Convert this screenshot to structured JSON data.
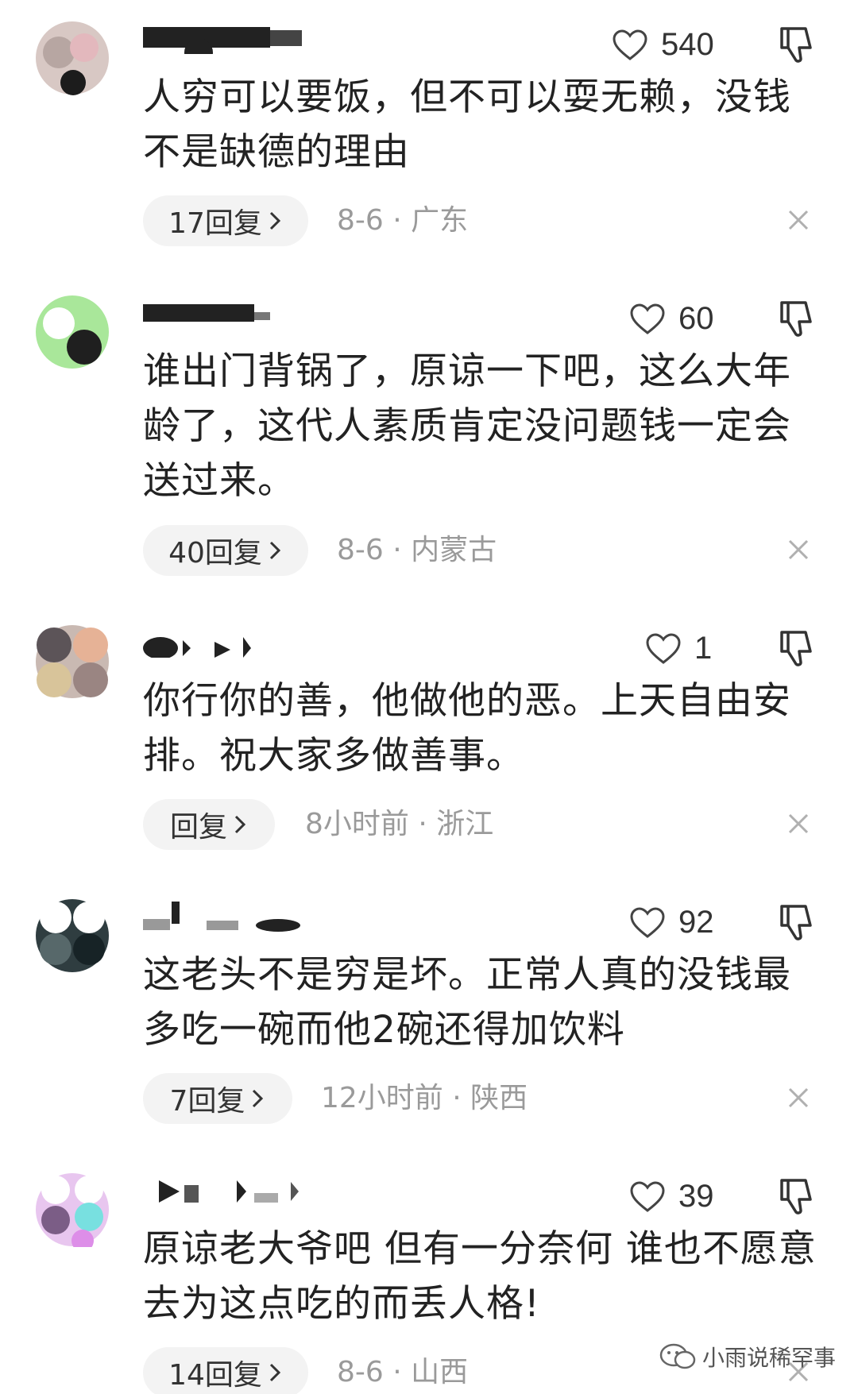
{
  "comments": [
    {
      "likes": "540",
      "text": "人穷可以要饭，但不可以耍无赖，没钱不是缺德的理由",
      "reply_label": "17回复",
      "meta": "8-6 · 广东"
    },
    {
      "likes": "60",
      "text": "谁出门背锅了，原谅一下吧，这么大年龄了，这代人素质肯定没问题钱一定会送过来。",
      "reply_label": "40回复",
      "meta": "8-6 · 内蒙古"
    },
    {
      "likes": "1",
      "text": "你行你的善，他做他的恶。上天自由安排。祝大家多做善事。",
      "reply_label": "回复",
      "meta": "8小时前 · 浙江"
    },
    {
      "likes": "92",
      "text": "这老头不是穷是坏。正常人真的没钱最多吃一碗而他2碗还得加饮料",
      "reply_label": "7回复",
      "meta": "12小时前 · 陕西"
    },
    {
      "likes": "39",
      "text": "原谅老大爷吧 但有一分奈何 谁也不愿意去为这点吃的而丢人格!",
      "reply_label": "14回复",
      "meta": "8-6 · 山西"
    }
  ],
  "watermark": {
    "text": "小雨说稀罕事",
    "icon": "wechat-icon"
  },
  "icons": {
    "like": "heart-outline-icon",
    "dislike": "thumbs-down-icon",
    "close": "close-icon",
    "chevron": "chevron-right-icon"
  }
}
